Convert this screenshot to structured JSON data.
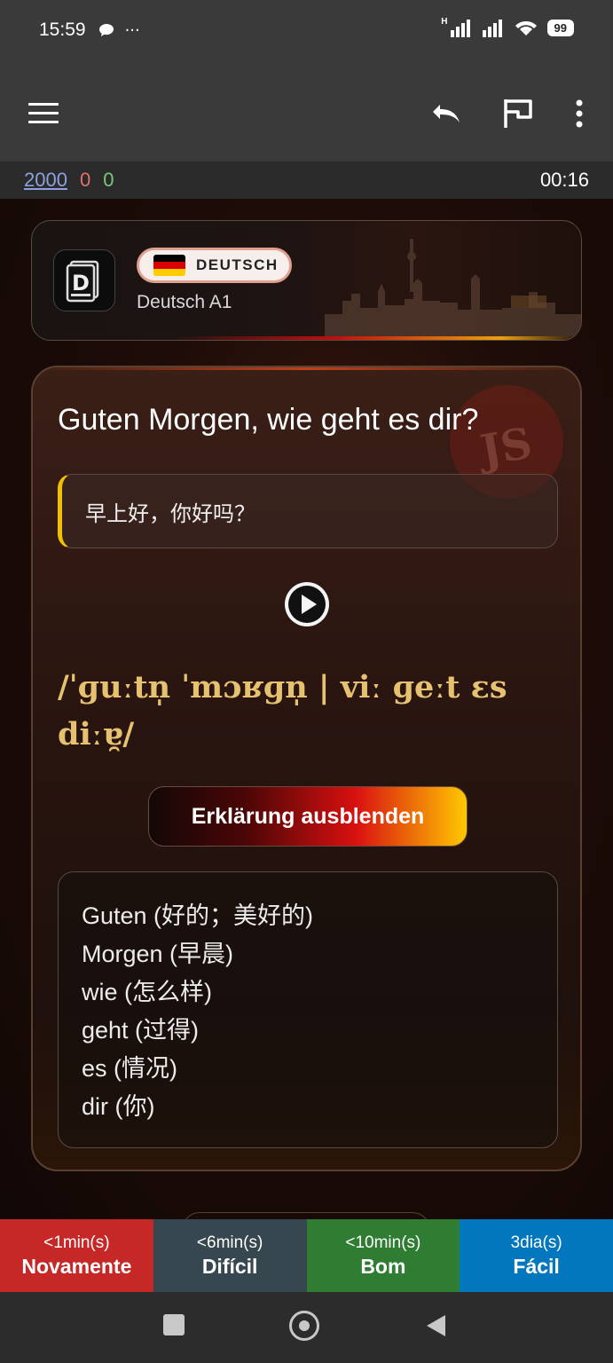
{
  "status_bar": {
    "time": "15:59",
    "notification_icon": "chat-bubble-icon",
    "more_dots": "···",
    "network_label": "H",
    "battery": "99"
  },
  "app_bar": {
    "icons": [
      "menu-icon",
      "undo-icon",
      "flag-icon",
      "more-vert-icon"
    ]
  },
  "counts": {
    "new": "2000",
    "learning": "0",
    "review": "0",
    "timer": "00:16",
    "colors": {
      "new": "#8ca0e0",
      "learning": "#e07070",
      "review": "#78c878"
    }
  },
  "deck": {
    "language_badge": "DEUTSCH",
    "deck_name": "Deutsch A1",
    "logo_letter": "D"
  },
  "card": {
    "front": "Guten Morgen, wie geht es dir?",
    "translation": "早上好，你好吗？",
    "ipa": "/ˈɡuːtn̩ ˈmɔʁɡn̩ | viː ɡeːt ɛs diːɐ̯/",
    "toggle_label": "Erklärung ausblenden",
    "watermark": "JS",
    "explanation": [
      "Guten (好的；美好的)",
      "Morgen (早晨)",
      "wie (怎么样)",
      "geht (过得)",
      "es (情况)",
      "dir (你)"
    ]
  },
  "answers": [
    {
      "time": "<1min(s)",
      "label": "Novamente",
      "color": "#c62828"
    },
    {
      "time": "<6min(s)",
      "label": "Difícil",
      "color": "#37474f"
    },
    {
      "time": "<10min(s)",
      "label": "Bom",
      "color": "#2e7d32"
    },
    {
      "time": "3dia(s)",
      "label": "Fácil",
      "color": "#0277bd"
    }
  ],
  "nav_bar": {
    "icons": [
      "recents-square-icon",
      "home-circle-icon",
      "back-triangle-icon"
    ]
  }
}
